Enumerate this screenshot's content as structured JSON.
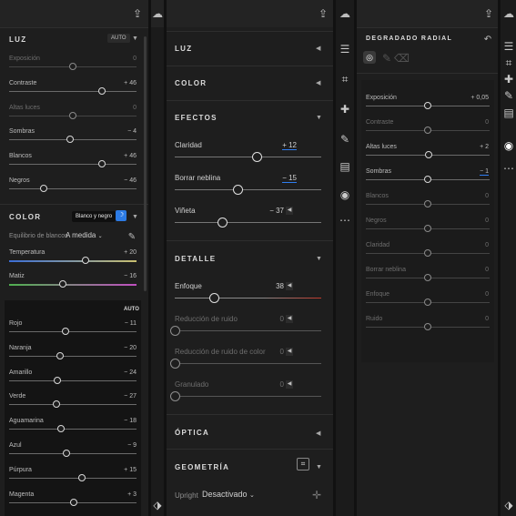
{
  "left": {
    "luz": {
      "title": "LUZ",
      "auto": "AUTO",
      "rows": [
        {
          "label": "Exposición",
          "value": "0",
          "pos": 0.5,
          "dim": true
        },
        {
          "label": "Contraste",
          "value": "+ 46",
          "pos": 0.73
        },
        {
          "label": "Altas luces",
          "value": "0",
          "pos": 0.5,
          "dim": true
        },
        {
          "label": "Sombras",
          "value": "− 4",
          "pos": 0.48
        },
        {
          "label": "Blancos",
          "value": "+ 46",
          "pos": 0.73
        },
        {
          "label": "Negros",
          "value": "− 46",
          "pos": 0.27
        }
      ]
    },
    "color": {
      "title": "COLOR",
      "tooltip": "Blanco y negro",
      "wb_label": "Equilibrio de blancos",
      "wb_value": "A medida",
      "rows": [
        {
          "label": "Temperatura",
          "value": "+ 20",
          "pos": 0.6
        },
        {
          "label": "Matiz",
          "value": "− 16",
          "pos": 0.42
        }
      ]
    },
    "bw": {
      "auto": "AUTO",
      "rows": [
        {
          "label": "Rojo",
          "value": "− 11",
          "pos": 0.44
        },
        {
          "label": "Naranja",
          "value": "− 20",
          "pos": 0.4
        },
        {
          "label": "Amarillo",
          "value": "− 24",
          "pos": 0.38
        },
        {
          "label": "Verde",
          "value": "− 27",
          "pos": 0.37
        },
        {
          "label": "Aguamarina",
          "value": "− 18",
          "pos": 0.41
        },
        {
          "label": "Azul",
          "value": "− 9",
          "pos": 0.45
        },
        {
          "label": "Púrpura",
          "value": "+ 15",
          "pos": 0.57
        },
        {
          "label": "Magenta",
          "value": "+ 3",
          "pos": 0.51
        }
      ]
    }
  },
  "center": {
    "luz": "LUZ",
    "color": "COLOR",
    "efectos": {
      "title": "EFECTOS",
      "rows": [
        {
          "label": "Claridad",
          "value": "+ 12",
          "pos": 0.56,
          "ul": true
        },
        {
          "label": "Borrar neblina",
          "value": "− 15",
          "pos": 0.43,
          "ul": true
        },
        {
          "label": "Viñeta",
          "value": "− 37",
          "pos": 0.32,
          "step": true
        }
      ]
    },
    "detalle": {
      "title": "DETALLE",
      "rows": [
        {
          "label": "Enfoque",
          "value": "38",
          "pos": 0.27,
          "step": true,
          "red": true
        },
        {
          "label": "Reducción de ruido",
          "value": "0",
          "pos": 0.0,
          "dim": true,
          "step": true
        },
        {
          "label": "Reducción de ruido de color",
          "value": "0",
          "pos": 0.0,
          "dim": true,
          "step": true
        },
        {
          "label": "Granulado",
          "value": "0",
          "pos": 0.0,
          "dim": true,
          "step": true
        }
      ]
    },
    "optica": "ÓPTICA",
    "geometria": {
      "title": "GEOMETRÍA",
      "upright_label": "Upright",
      "upright_value": "Desactivado"
    }
  },
  "right": {
    "title": "DEGRADADO RADIAL",
    "rows": [
      {
        "label": "Exposición",
        "value": "+ 0,05",
        "pos": 0.5
      },
      {
        "label": "Contraste",
        "value": "0",
        "pos": 0.5,
        "dim": true
      },
      {
        "label": "Altas luces",
        "value": "+ 2",
        "pos": 0.51
      },
      {
        "label": "Sombras",
        "value": "− 1",
        "pos": 0.5,
        "ul": true
      },
      {
        "label": "Blancos",
        "value": "0",
        "pos": 0.5,
        "dim": true
      },
      {
        "label": "Negros",
        "value": "0",
        "pos": 0.5,
        "dim": true
      },
      {
        "label": "Claridad",
        "value": "0",
        "pos": 0.5,
        "dim": true
      },
      {
        "label": "Borrar neblina",
        "value": "0",
        "pos": 0.5,
        "dim": true
      },
      {
        "label": "Enfoque",
        "value": "0",
        "pos": 0.5,
        "dim": true
      },
      {
        "label": "Ruido",
        "value": "0",
        "pos": 0.5,
        "dim": true
      }
    ]
  },
  "colors": {
    "accent": "#2c7be5",
    "underline": "#2f7df0",
    "enfoque_red": "#c0392b"
  },
  "icons": [
    "share-icon",
    "cloud-sync-icon",
    "sliders-icon",
    "crop-icon",
    "healing-icon",
    "brush-icon",
    "linear-gradient-icon",
    "radial-gradient-icon",
    "more-icon",
    "tag-icon"
  ]
}
